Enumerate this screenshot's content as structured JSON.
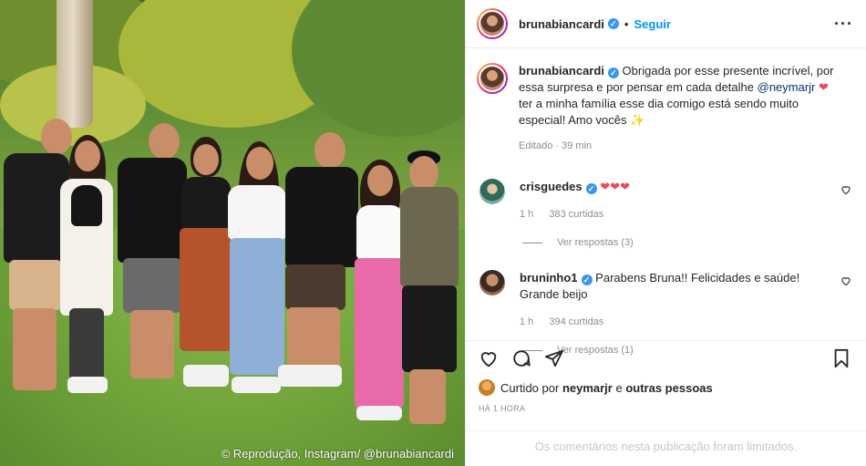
{
  "header": {
    "username": "brunabiancardi",
    "verified_badge": "✓",
    "separator": "•",
    "follow_label": "Seguir",
    "more_label": "···"
  },
  "caption": {
    "username": "brunabiancardi",
    "text_before": "Obrigada por esse presente incrível, por essa surpresa e por pensar em cada detalhe",
    "mention": "@neymarjr",
    "heart": "❤",
    "text_after": "ter a minha família esse dia comigo está sendo muito especial! Amo vocês",
    "emoji": "✨",
    "edited": "Editado",
    "time": "39 min"
  },
  "comments": [
    {
      "username": "crisguedes",
      "text": "❤❤❤",
      "time": "1 h",
      "likes": "383 curtidas",
      "replies": "Ver respostas (3)"
    },
    {
      "username": "bruninho1",
      "text": "Parabens Bruna!! Felicidades e saúde! Grande beijo",
      "time": "1 h",
      "likes": "394 curtidas",
      "replies": "Ver respostas (1)"
    }
  ],
  "likes": {
    "prefix": "Curtido por",
    "user": "neymarjr",
    "connector": "e",
    "others": "outras pessoas"
  },
  "post_time": "HÁ 1 HORA",
  "comments_limited": "Os comentários nesta publicação foram limitados.",
  "watermark": "© Reprodução, Instagram/ @brunabiancardi",
  "icons": [
    "heart-icon",
    "comment-icon",
    "share-icon",
    "bookmark-icon",
    "more-icon",
    "verified-icon"
  ],
  "colors": {
    "link": "#0095f6",
    "mention": "#00376b",
    "heart": "#ed4956",
    "verified": "#3897f0",
    "muted": "#8e8e8e"
  }
}
